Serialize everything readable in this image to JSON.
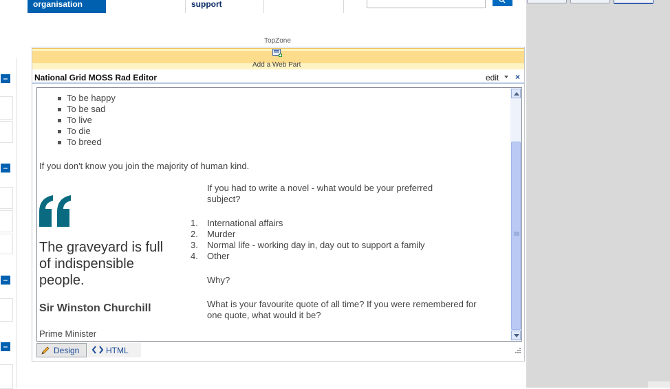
{
  "topnav": {
    "org_label": "organisation",
    "support_label": "support"
  },
  "zone": {
    "label": "TopZone",
    "add_webpart_label": "Add a Web Part"
  },
  "webpart": {
    "title": "National Grid MOSS Rad Editor",
    "edit_label": "edit",
    "close_glyph": "×"
  },
  "content": {
    "bullets": [
      "To be happy",
      "To be sad",
      "To live",
      "To die",
      "To breed"
    ],
    "intro": "If you don't know you join the majority of human kind.",
    "question1_line1": "If you had to write a novel - what would be your preferred",
    "question1_line2": "subject?",
    "options": [
      {
        "num": "1.",
        "text": "International affairs"
      },
      {
        "num": "2.",
        "text": "Murder"
      },
      {
        "num": "3.",
        "text": "Normal life - working day in, day out to support a family"
      },
      {
        "num": "4.",
        "text": "Other"
      }
    ],
    "why": "Why?",
    "question2_line1": "What is your favourite quote of all time? If you were remembered for",
    "question2_line2": "one quote, what would it be?",
    "quote_line1": "The graveyard is full",
    "quote_line2": "of indispensible",
    "quote_line3": "people.",
    "quote_author": "Sir Winston Churchill",
    "quote_role": "Prime Minister"
  },
  "toolbar": {
    "design_label": "Design",
    "html_label": "HTML"
  },
  "colors": {
    "brand_blue": "#0060b0",
    "quote_teal": "#0a6b80",
    "zone_yellow": "#fddc8b"
  },
  "icons": [
    "search-icon",
    "collapse-icon",
    "add-webpart-icon",
    "pencil-icon",
    "code-icon",
    "resize-grip-icon",
    "quote-mark-icon"
  ]
}
